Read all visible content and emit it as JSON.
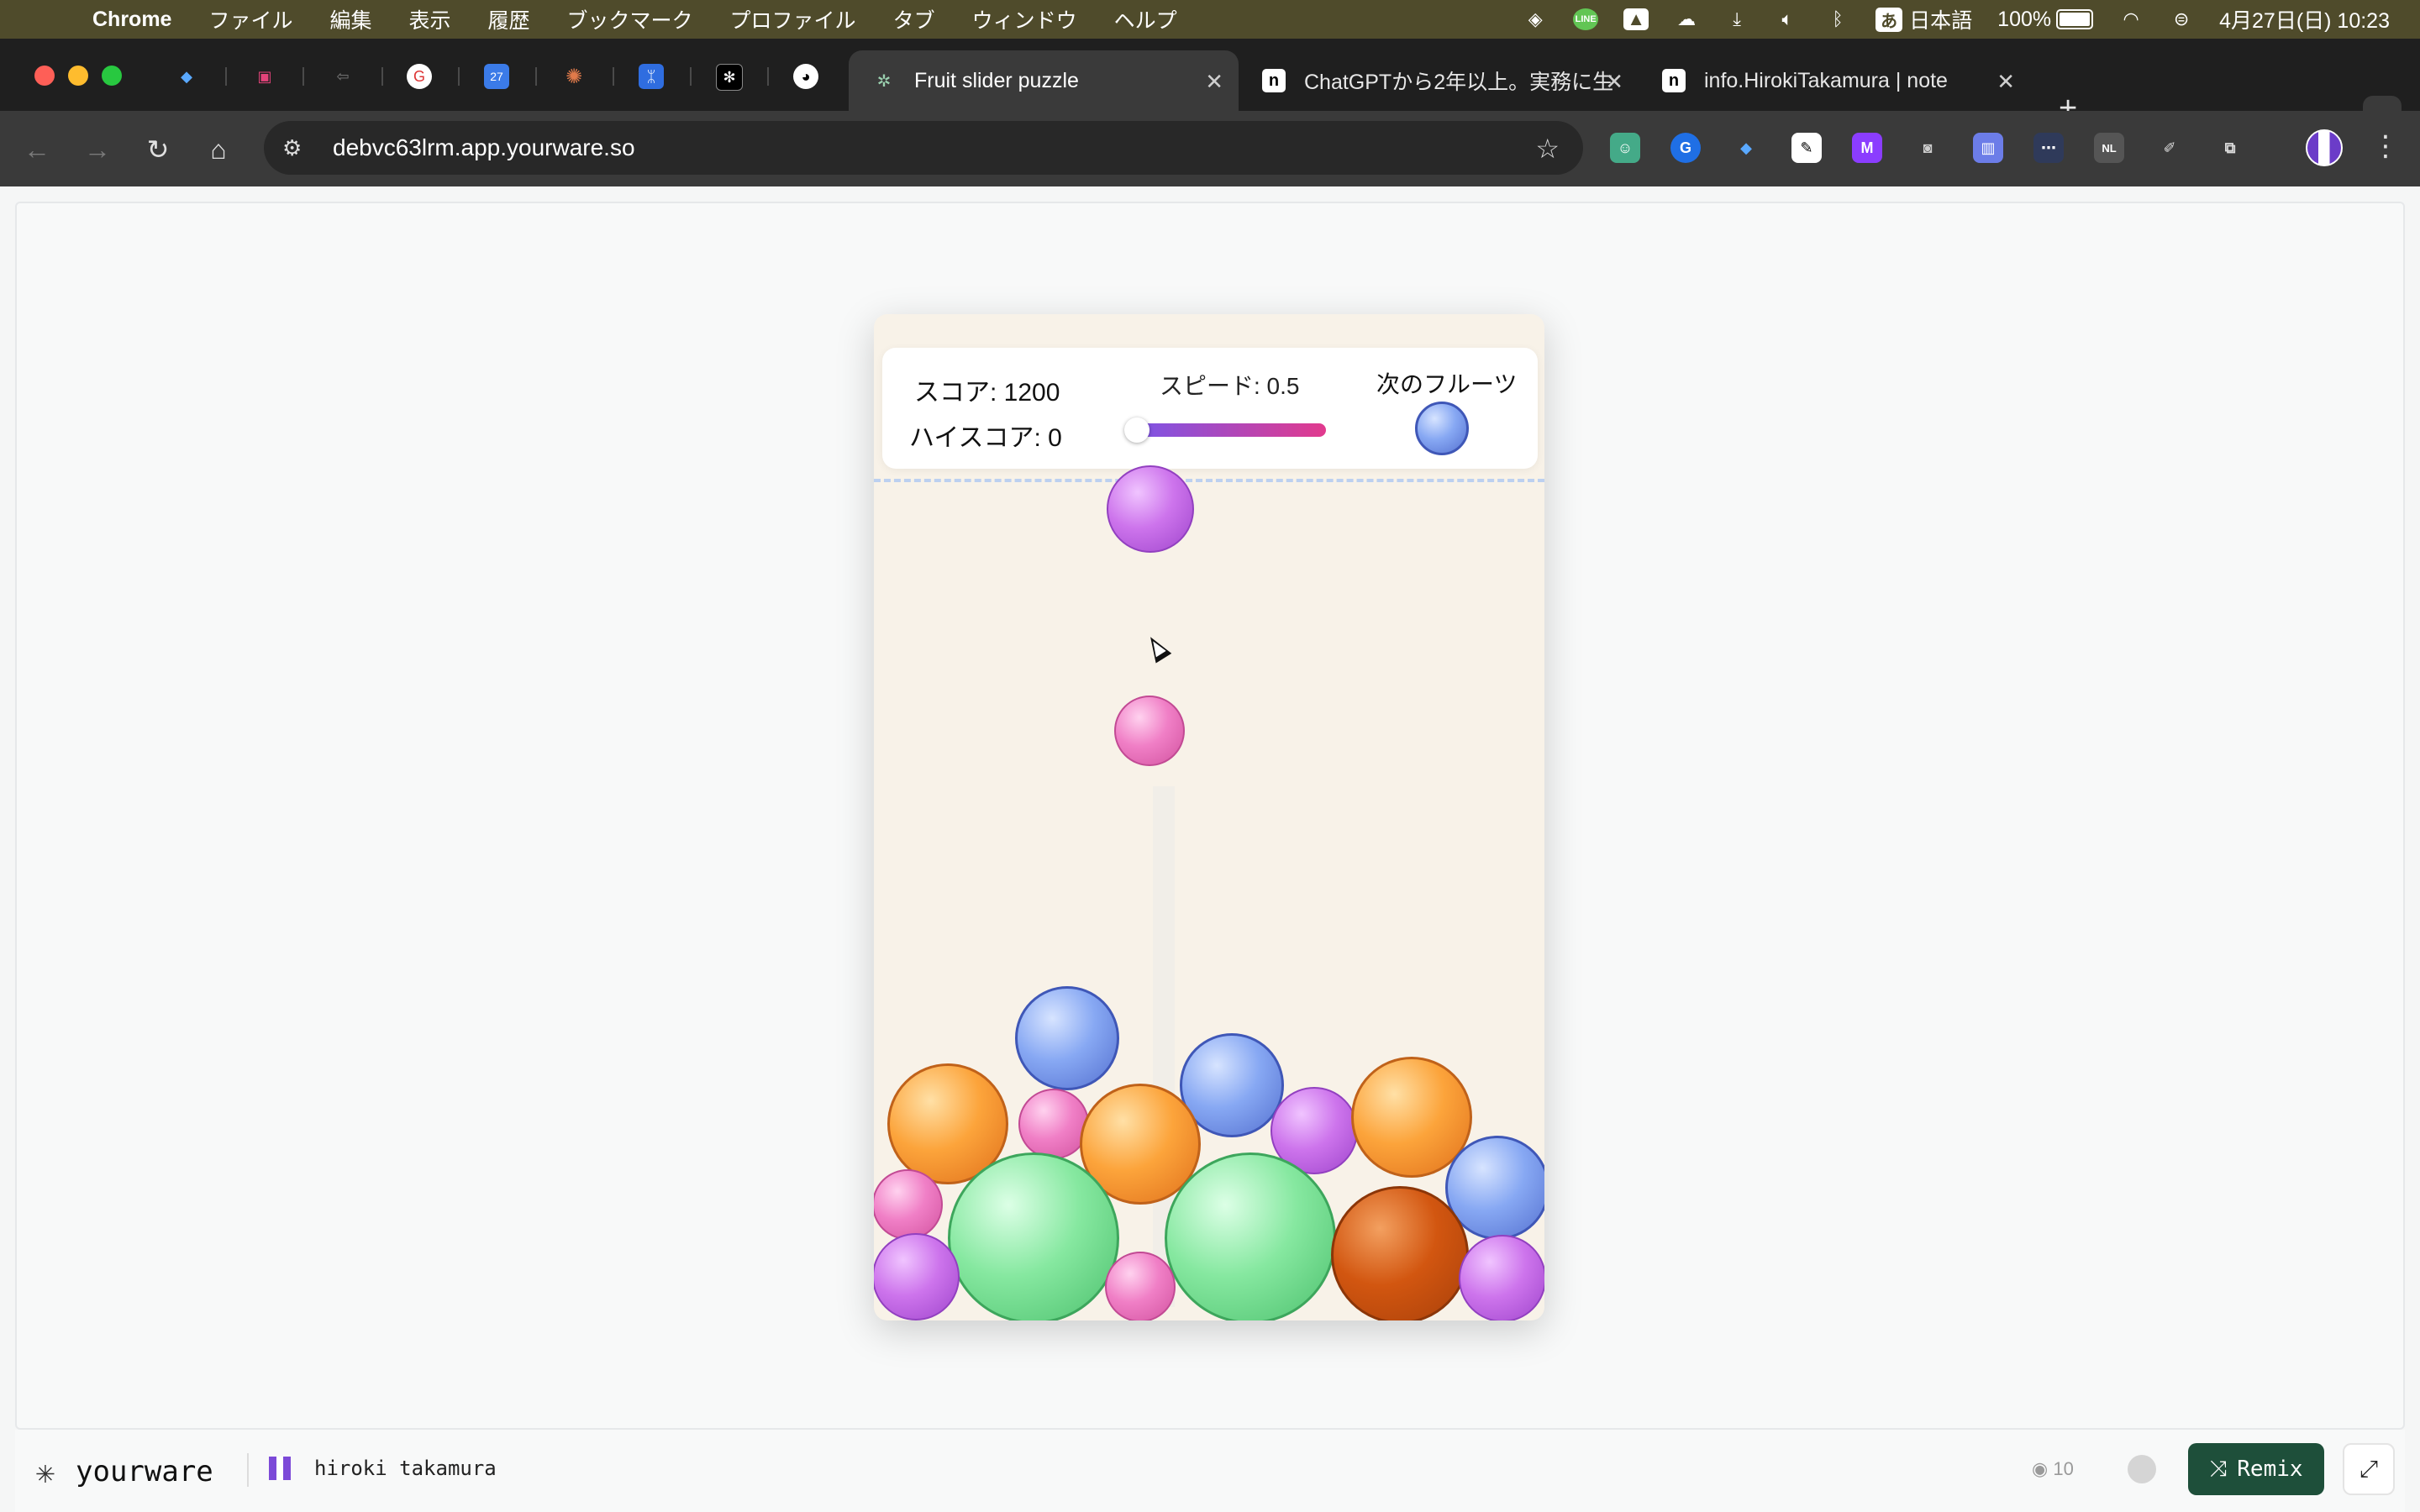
{
  "menubar": {
    "app_name": "Chrome",
    "items": [
      "ファイル",
      "編集",
      "表示",
      "履歴",
      "ブックマーク",
      "プロファイル",
      "タブ",
      "ウィンドウ",
      "ヘルプ"
    ],
    "ime": "あ",
    "language": "日本語",
    "battery": "100%",
    "datetime": "4月27日(日) 10:23"
  },
  "tabs": [
    {
      "title": "Fruit slider puzzle",
      "active": true
    },
    {
      "title": "ChatGPTから2年以上。実務に生",
      "active": false
    },
    {
      "title": "info.HirokiTakamura | note",
      "active": false
    }
  ],
  "toolbar": {
    "url": "debvc63lrm.app.yourware.so"
  },
  "game": {
    "score_text": "スコア: 1200",
    "high_score_text": "ハイスコア: 0",
    "speed_text": "スピード: 0.5",
    "speed_value": 0.5,
    "next_fruit_label": "次のフルーツ",
    "next_fruit": "blueberry",
    "colors": {
      "grape": "#c46ae6",
      "cherry": "#ec7cc3",
      "blueberry": "#7b9cf0",
      "orange": "#f79a33",
      "melon": "#7ce39a",
      "persimmon": "#c85010",
      "slider_start": "#7a55e8",
      "slider_end": "#e23a8d"
    }
  },
  "footer": {
    "brand": "yourware",
    "author": "hiroki takamura",
    "views": "10",
    "remix_label": "Remix"
  }
}
